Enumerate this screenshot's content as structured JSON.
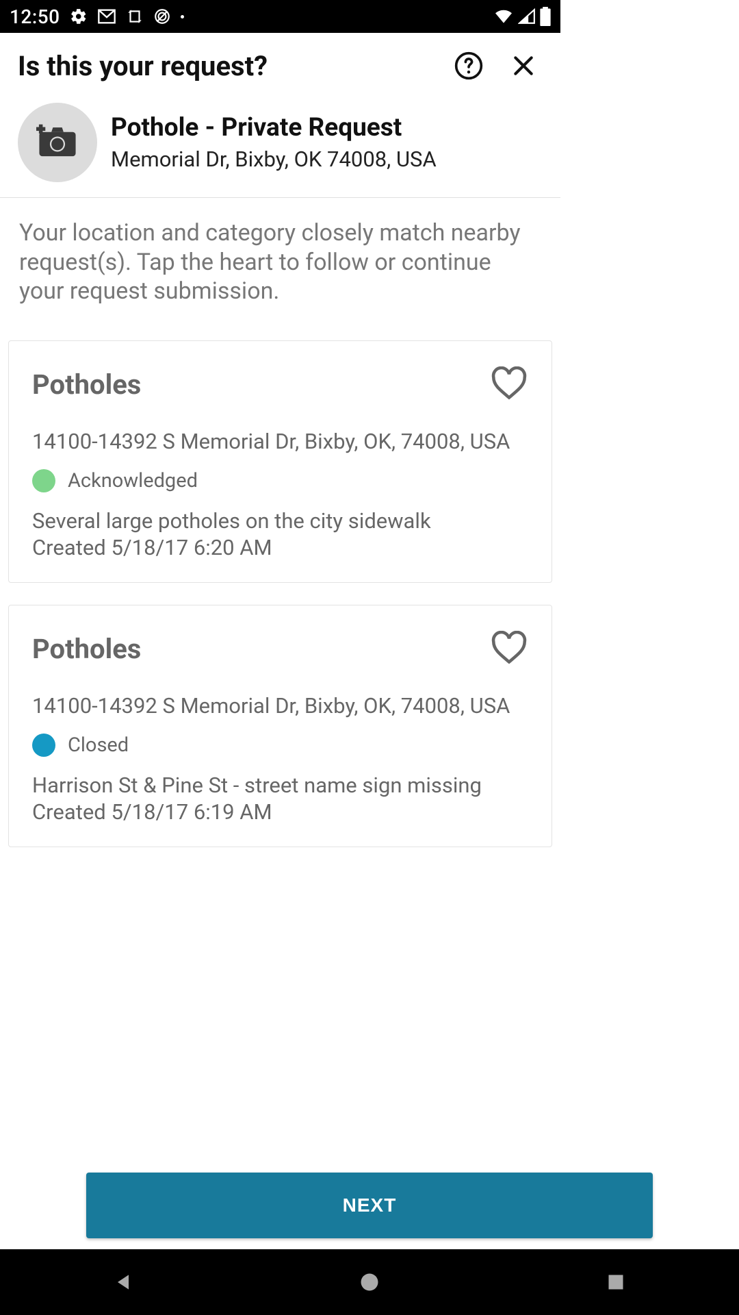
{
  "status_bar": {
    "time": "12:50"
  },
  "app_bar": {
    "title": "Is this your request?"
  },
  "summary": {
    "title": "Pothole - Private Request",
    "address": "Memorial Dr, Bixby, OK 74008, USA"
  },
  "hint": "Your location and category closely match nearby request(s). Tap the heart to follow or continue your request submission.",
  "cards": [
    {
      "title": "Potholes",
      "address": "14100-14392 S Memorial Dr, Bixby, OK, 74008, USA",
      "status": "Acknowledged",
      "status_color": "green",
      "description": "Several large potholes on the city sidewalk",
      "created": "Created 5/18/17 6:20 AM"
    },
    {
      "title": "Potholes",
      "address": "14100-14392 S Memorial Dr, Bixby, OK, 74008, USA",
      "status": "Closed",
      "status_color": "blue",
      "description": "Harrison St & Pine St - street name sign missing",
      "created": "Created 5/18/17 6:19 AM"
    }
  ],
  "footer": {
    "next": "NEXT"
  }
}
